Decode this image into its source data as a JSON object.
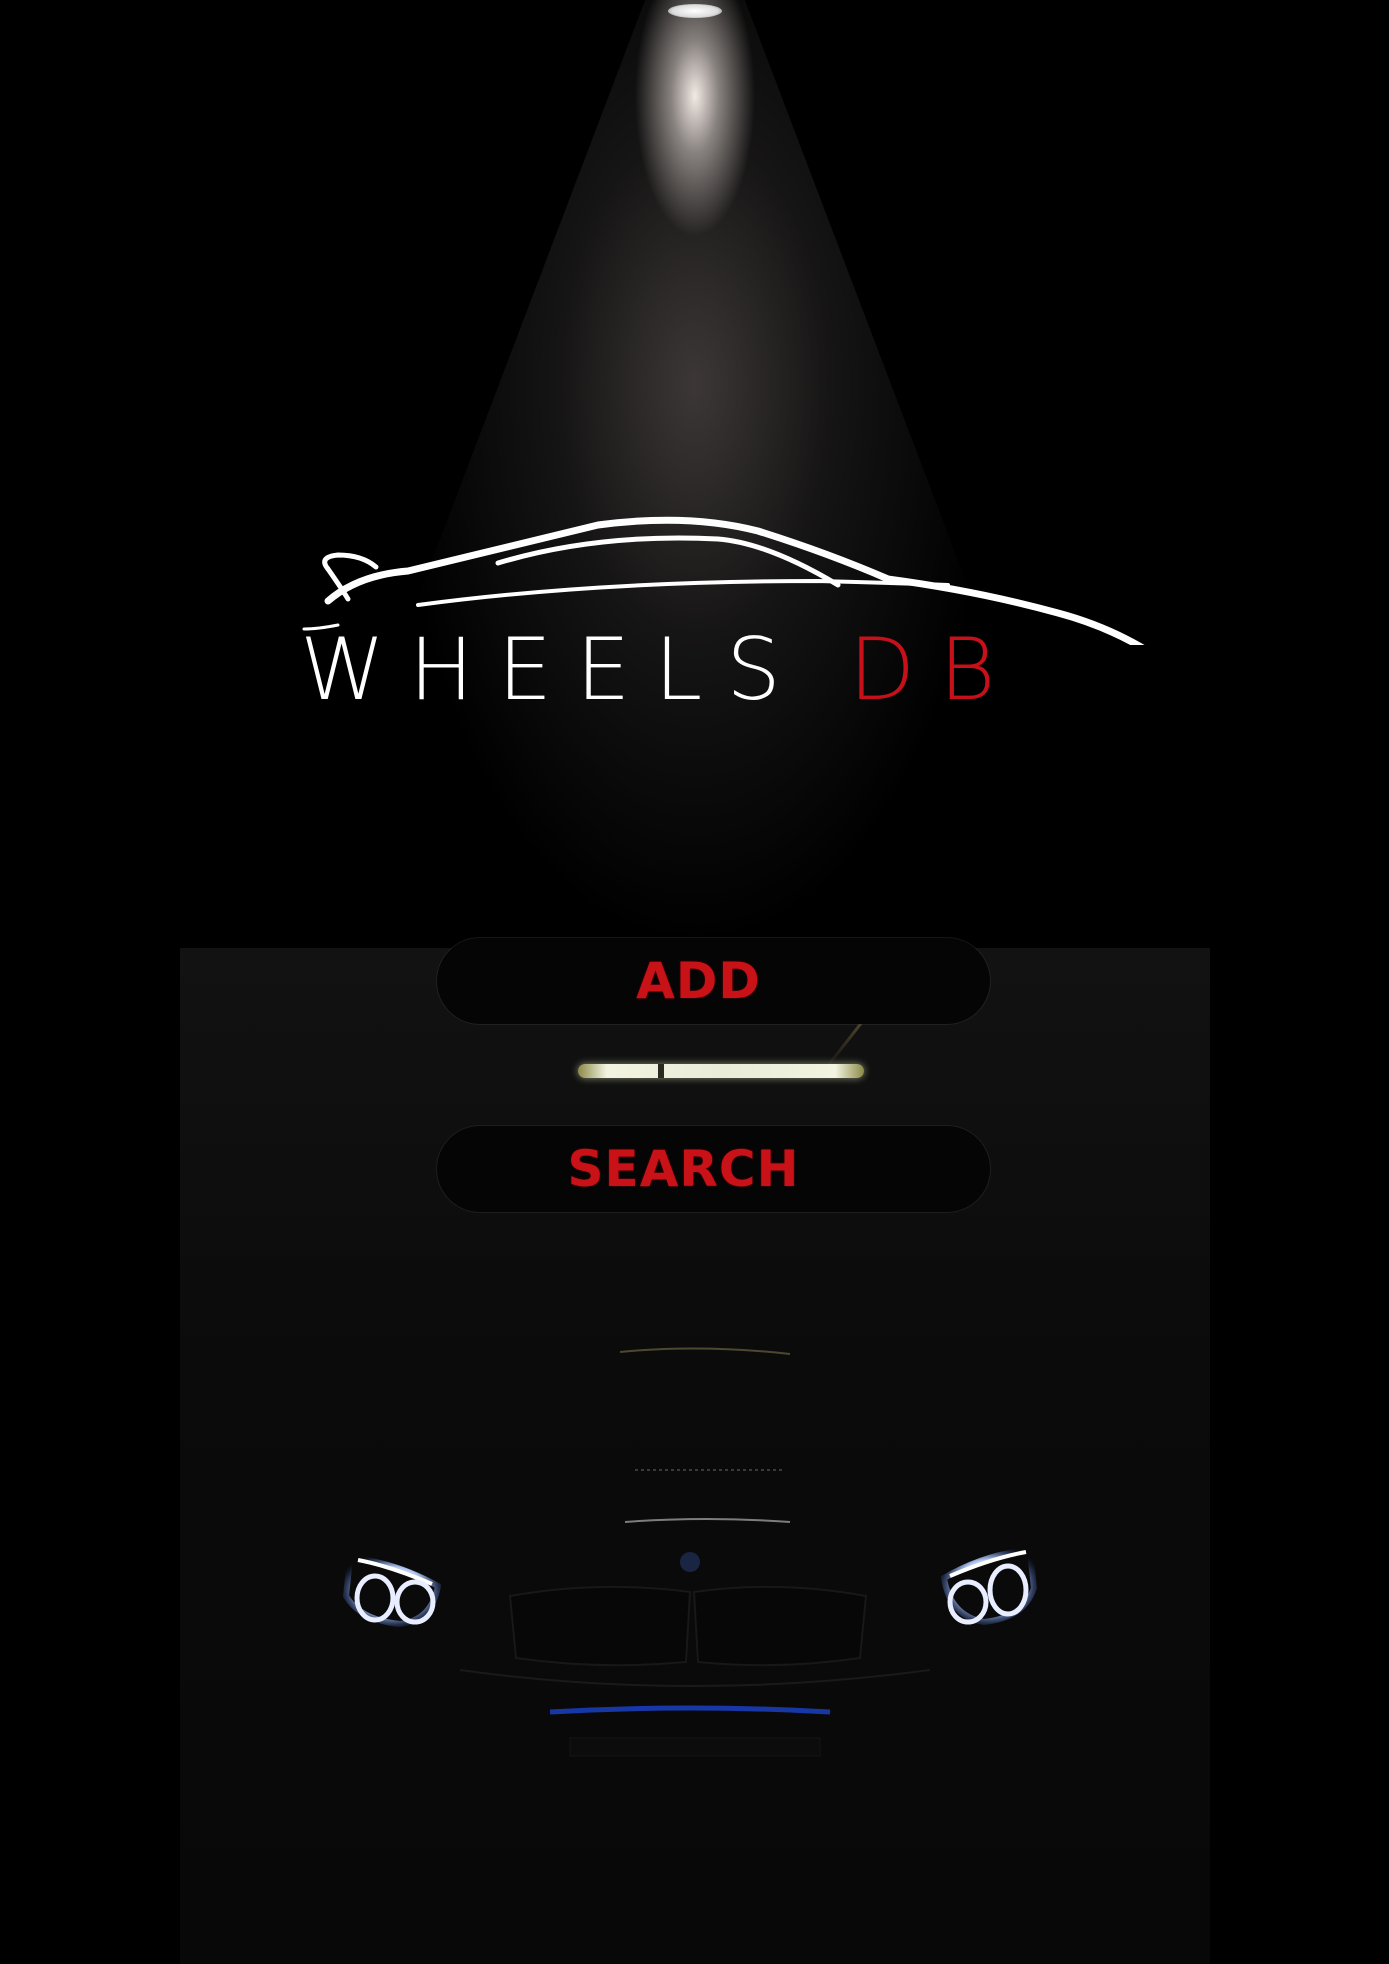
{
  "logo": {
    "word1": "WHEELS",
    "word2": "DB",
    "colors": {
      "primary": "#ffffff",
      "accent": "#c8101a"
    }
  },
  "actions": {
    "add_label": "ADD",
    "search_label": "SEARCH"
  },
  "theme": {
    "background": "#000000",
    "button_background": "#050505",
    "button_text": "#c81218",
    "headlight_glow": "#dfe8ff"
  },
  "icons": {
    "logo_mark": "car-silhouette-icon",
    "spotlight": "spotlight",
    "hero_image": "car-front-headlights"
  }
}
